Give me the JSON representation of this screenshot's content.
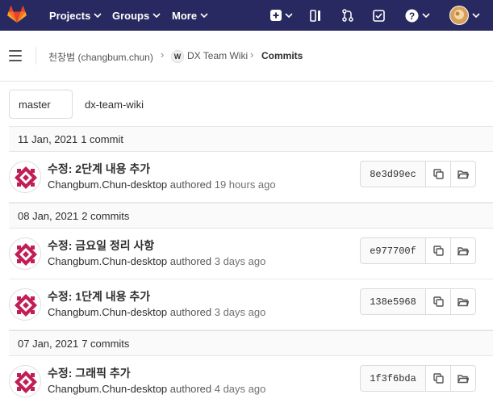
{
  "nav": {
    "projects": "Projects",
    "groups": "Groups",
    "more": "More"
  },
  "breadcrumb": {
    "user": "천창범 (changbum.chun)",
    "wiki_badge": "W",
    "project": "DX Team Wiki",
    "current": "Commits"
  },
  "branch": {
    "selected": "master",
    "path": "dx-team-wiki"
  },
  "days": [
    {
      "date": "11 Jan, 2021",
      "count": "1 commit"
    },
    {
      "date": "08 Jan, 2021",
      "count": "2 commits"
    },
    {
      "date": "07 Jan, 2021",
      "count": "7 commits"
    }
  ],
  "commits": [
    {
      "title": "수정: 2단계 내용 추가",
      "author": "Changbum.Chun-desktop",
      "authored": "authored",
      "when": "19 hours ago",
      "sha": "8e3d99ec"
    },
    {
      "title": "수정: 금요일 정리 사항",
      "author": "Changbum.Chun-desktop",
      "authored": "authored",
      "when": "3 days ago",
      "sha": "e977700f"
    },
    {
      "title": "수정: 1단계 내용 추가",
      "author": "Changbum.Chun-desktop",
      "authored": "authored",
      "when": "3 days ago",
      "sha": "138e5968"
    },
    {
      "title": "수정: 그래픽 추가",
      "author": "Changbum.Chun-desktop",
      "authored": "authored",
      "when": "4 days ago",
      "sha": "1f3f6bda"
    }
  ],
  "colors": {
    "navbar": "#292961",
    "logo": "#e24329",
    "avatar_pattern": "#c21e56"
  }
}
